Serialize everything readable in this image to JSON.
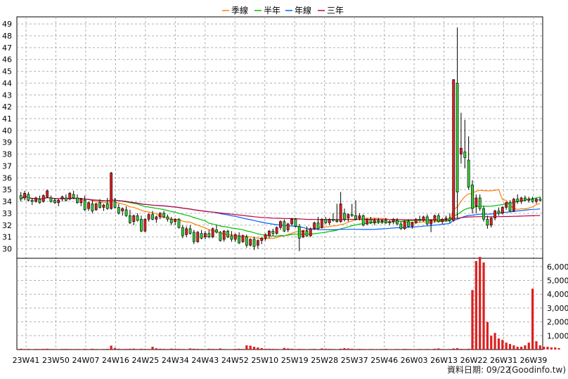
{
  "chart_data": {
    "type": "candlestick",
    "legend": [
      {
        "name": "季線",
        "color": "#ff8000"
      },
      {
        "name": "半年",
        "color": "#00c000"
      },
      {
        "name": "年線",
        "color": "#0060ff"
      },
      {
        "name": "三年",
        "color": "#c00040"
      }
    ],
    "price_axis": {
      "ticks": [
        30,
        31,
        32,
        33,
        34,
        35,
        36,
        37,
        38,
        39,
        40,
        41,
        42,
        43,
        44,
        45,
        46,
        47,
        48,
        49
      ],
      "ylim": [
        29.2,
        49.6
      ]
    },
    "volume_axis": {
      "ticks": [
        1000,
        2000,
        3000,
        4000,
        5000,
        6000
      ],
      "tick_labels": [
        "1,000",
        "2,000",
        "3,000",
        "4,000",
        "5,000",
        "6,000"
      ],
      "ylim": [
        0,
        6600
      ]
    },
    "x_labels": [
      "23W41",
      "23W50",
      "24W07",
      "24W16",
      "24W25",
      "24W34",
      "24W43",
      "24W52",
      "25W10",
      "25W19",
      "25W28",
      "25W37",
      "25W46",
      "26W03",
      "26W13",
      "26W22",
      "26W31",
      "26W39"
    ],
    "footer": "資料日期: 09/22",
    "footer_source": "(Goodinfo.tw)",
    "candles": [
      {
        "o": 34.5,
        "h": 34.8,
        "l": 34.0,
        "c": 34.2
      },
      {
        "o": 34.3,
        "h": 34.9,
        "l": 34.1,
        "c": 34.7
      },
      {
        "o": 34.6,
        "h": 34.8,
        "l": 34.0,
        "c": 34.1
      },
      {
        "o": 34.1,
        "h": 34.3,
        "l": 33.7,
        "c": 34.0
      },
      {
        "o": 34.0,
        "h": 34.4,
        "l": 33.9,
        "c": 34.3
      },
      {
        "o": 34.2,
        "h": 34.5,
        "l": 33.8,
        "c": 33.9
      },
      {
        "o": 34.0,
        "h": 34.6,
        "l": 33.9,
        "c": 34.5
      },
      {
        "o": 34.4,
        "h": 35.0,
        "l": 34.3,
        "c": 34.9
      },
      {
        "o": 34.3,
        "h": 34.5,
        "l": 33.9,
        "c": 34.0
      },
      {
        "o": 34.1,
        "h": 34.3,
        "l": 33.8,
        "c": 33.9
      },
      {
        "o": 33.9,
        "h": 34.2,
        "l": 33.6,
        "c": 34.1
      },
      {
        "o": 34.2,
        "h": 34.5,
        "l": 34.0,
        "c": 34.4
      },
      {
        "o": 34.3,
        "h": 34.6,
        "l": 34.0,
        "c": 34.1
      },
      {
        "o": 34.2,
        "h": 34.8,
        "l": 34.1,
        "c": 34.7
      },
      {
        "o": 34.6,
        "h": 34.9,
        "l": 34.2,
        "c": 34.3
      },
      {
        "o": 34.3,
        "h": 34.6,
        "l": 33.8,
        "c": 33.9
      },
      {
        "o": 33.9,
        "h": 34.3,
        "l": 33.6,
        "c": 34.2
      },
      {
        "o": 34.1,
        "h": 34.5,
        "l": 33.2,
        "c": 33.3
      },
      {
        "o": 33.4,
        "h": 34.0,
        "l": 33.2,
        "c": 33.9
      },
      {
        "o": 33.8,
        "h": 34.1,
        "l": 33.0,
        "c": 33.2
      },
      {
        "o": 33.3,
        "h": 33.9,
        "l": 33.2,
        "c": 33.8
      },
      {
        "o": 33.9,
        "h": 34.2,
        "l": 33.4,
        "c": 33.5
      },
      {
        "o": 33.5,
        "h": 33.8,
        "l": 33.2,
        "c": 33.7
      },
      {
        "o": 33.8,
        "h": 34.3,
        "l": 33.3,
        "c": 33.4
      },
      {
        "o": 33.4,
        "h": 36.5,
        "l": 33.3,
        "c": 36.4
      },
      {
        "o": 34.0,
        "h": 34.3,
        "l": 33.4,
        "c": 33.5
      },
      {
        "o": 33.5,
        "h": 33.8,
        "l": 32.9,
        "c": 33.0
      },
      {
        "o": 33.2,
        "h": 33.5,
        "l": 32.8,
        "c": 33.4
      },
      {
        "o": 33.3,
        "h": 33.6,
        "l": 32.7,
        "c": 32.8
      },
      {
        "o": 32.8,
        "h": 33.3,
        "l": 32.1,
        "c": 32.2
      },
      {
        "o": 32.3,
        "h": 32.9,
        "l": 32.0,
        "c": 32.8
      },
      {
        "o": 32.8,
        "h": 33.0,
        "l": 32.3,
        "c": 32.4
      },
      {
        "o": 32.5,
        "h": 32.8,
        "l": 31.4,
        "c": 31.5
      },
      {
        "o": 31.5,
        "h": 32.6,
        "l": 31.4,
        "c": 32.5
      },
      {
        "o": 32.5,
        "h": 33.0,
        "l": 32.3,
        "c": 32.9
      },
      {
        "o": 32.9,
        "h": 33.2,
        "l": 32.4,
        "c": 32.5
      },
      {
        "o": 32.5,
        "h": 32.8,
        "l": 32.2,
        "c": 32.7
      },
      {
        "o": 32.7,
        "h": 33.1,
        "l": 32.5,
        "c": 33.0
      },
      {
        "o": 33.0,
        "h": 33.2,
        "l": 32.6,
        "c": 32.7
      },
      {
        "o": 32.7,
        "h": 32.9,
        "l": 32.3,
        "c": 32.5
      },
      {
        "o": 32.5,
        "h": 32.7,
        "l": 32.0,
        "c": 32.2
      },
      {
        "o": 32.3,
        "h": 32.6,
        "l": 32.0,
        "c": 32.5
      },
      {
        "o": 32.5,
        "h": 32.6,
        "l": 31.7,
        "c": 31.8
      },
      {
        "o": 31.8,
        "h": 32.0,
        "l": 30.9,
        "c": 31.1
      },
      {
        "o": 31.2,
        "h": 31.9,
        "l": 31.0,
        "c": 31.7
      },
      {
        "o": 31.7,
        "h": 32.0,
        "l": 31.2,
        "c": 31.3
      },
      {
        "o": 31.4,
        "h": 31.6,
        "l": 30.4,
        "c": 30.6
      },
      {
        "o": 30.6,
        "h": 31.5,
        "l": 30.5,
        "c": 31.4
      },
      {
        "o": 31.3,
        "h": 31.6,
        "l": 30.8,
        "c": 30.9
      },
      {
        "o": 31.0,
        "h": 31.5,
        "l": 30.8,
        "c": 31.3
      },
      {
        "o": 31.3,
        "h": 31.6,
        "l": 30.9,
        "c": 31.0
      },
      {
        "o": 31.0,
        "h": 31.8,
        "l": 30.9,
        "c": 31.7
      },
      {
        "o": 31.6,
        "h": 32.0,
        "l": 31.3,
        "c": 31.4
      },
      {
        "o": 31.4,
        "h": 31.5,
        "l": 30.6,
        "c": 30.7
      },
      {
        "o": 30.8,
        "h": 31.6,
        "l": 30.6,
        "c": 31.5
      },
      {
        "o": 31.5,
        "h": 31.6,
        "l": 30.9,
        "c": 31.0
      },
      {
        "o": 31.1,
        "h": 31.5,
        "l": 30.6,
        "c": 30.8
      },
      {
        "o": 30.8,
        "h": 31.3,
        "l": 30.6,
        "c": 31.2
      },
      {
        "o": 31.1,
        "h": 31.4,
        "l": 30.4,
        "c": 30.5
      },
      {
        "o": 30.6,
        "h": 31.2,
        "l": 30.5,
        "c": 31.1
      },
      {
        "o": 31.0,
        "h": 31.2,
        "l": 30.1,
        "c": 30.3
      },
      {
        "o": 30.3,
        "h": 30.9,
        "l": 30.2,
        "c": 30.8
      },
      {
        "o": 30.8,
        "h": 31.0,
        "l": 29.9,
        "c": 30.2
      },
      {
        "o": 30.3,
        "h": 30.8,
        "l": 30.0,
        "c": 30.7
      },
      {
        "o": 30.7,
        "h": 31.0,
        "l": 30.4,
        "c": 30.9
      },
      {
        "o": 30.9,
        "h": 31.3,
        "l": 30.7,
        "c": 31.2
      },
      {
        "o": 31.1,
        "h": 31.6,
        "l": 30.9,
        "c": 31.5
      },
      {
        "o": 31.5,
        "h": 31.7,
        "l": 31.1,
        "c": 31.3
      },
      {
        "o": 31.3,
        "h": 31.9,
        "l": 31.2,
        "c": 31.8
      },
      {
        "o": 31.8,
        "h": 32.4,
        "l": 31.6,
        "c": 32.3
      },
      {
        "o": 32.3,
        "h": 32.5,
        "l": 31.4,
        "c": 31.5
      },
      {
        "o": 31.6,
        "h": 32.2,
        "l": 31.4,
        "c": 32.1
      },
      {
        "o": 32.1,
        "h": 32.6,
        "l": 32.0,
        "c": 32.5
      },
      {
        "o": 32.5,
        "h": 32.6,
        "l": 31.8,
        "c": 31.9
      },
      {
        "o": 31.9,
        "h": 32.1,
        "l": 29.8,
        "c": 30.9
      },
      {
        "o": 31.0,
        "h": 31.6,
        "l": 30.9,
        "c": 31.5
      },
      {
        "o": 31.5,
        "h": 31.9,
        "l": 31.0,
        "c": 31.1
      },
      {
        "o": 31.1,
        "h": 31.8,
        "l": 31.0,
        "c": 31.7
      },
      {
        "o": 31.7,
        "h": 32.3,
        "l": 31.6,
        "c": 32.2
      },
      {
        "o": 32.2,
        "h": 32.7,
        "l": 31.6,
        "c": 31.7
      },
      {
        "o": 31.8,
        "h": 32.6,
        "l": 31.7,
        "c": 32.5
      },
      {
        "o": 32.5,
        "h": 32.7,
        "l": 32.1,
        "c": 32.2
      },
      {
        "o": 32.2,
        "h": 32.6,
        "l": 32.0,
        "c": 32.5
      },
      {
        "o": 32.5,
        "h": 33.0,
        "l": 32.3,
        "c": 32.4
      },
      {
        "o": 32.4,
        "h": 33.8,
        "l": 32.2,
        "c": 32.3
      },
      {
        "o": 32.3,
        "h": 34.8,
        "l": 32.2,
        "c": 33.8
      },
      {
        "o": 33.0,
        "h": 33.4,
        "l": 32.3,
        "c": 32.5
      },
      {
        "o": 32.6,
        "h": 33.0,
        "l": 32.3,
        "c": 32.9
      },
      {
        "o": 32.9,
        "h": 33.8,
        "l": 32.7,
        "c": 32.8
      },
      {
        "o": 32.8,
        "h": 34.1,
        "l": 32.4,
        "c": 32.5
      },
      {
        "o": 32.6,
        "h": 33.0,
        "l": 32.4,
        "c": 32.8
      },
      {
        "o": 32.8,
        "h": 32.9,
        "l": 31.9,
        "c": 32.0
      },
      {
        "o": 32.1,
        "h": 32.6,
        "l": 32.0,
        "c": 32.5
      },
      {
        "o": 32.5,
        "h": 32.7,
        "l": 32.1,
        "c": 32.2
      },
      {
        "o": 32.2,
        "h": 32.6,
        "l": 32.0,
        "c": 32.4
      },
      {
        "o": 32.4,
        "h": 32.6,
        "l": 32.1,
        "c": 32.3
      },
      {
        "o": 32.3,
        "h": 32.5,
        "l": 32.1,
        "c": 32.4
      },
      {
        "o": 32.4,
        "h": 32.6,
        "l": 32.1,
        "c": 32.2
      },
      {
        "o": 32.2,
        "h": 32.4,
        "l": 32.0,
        "c": 32.3
      },
      {
        "o": 32.3,
        "h": 32.6,
        "l": 32.1,
        "c": 32.5
      },
      {
        "o": 32.4,
        "h": 32.6,
        "l": 32.0,
        "c": 32.1
      },
      {
        "o": 32.1,
        "h": 32.3,
        "l": 31.6,
        "c": 31.7
      },
      {
        "o": 31.7,
        "h": 32.4,
        "l": 31.6,
        "c": 32.3
      },
      {
        "o": 32.3,
        "h": 32.5,
        "l": 31.8,
        "c": 31.9
      },
      {
        "o": 31.9,
        "h": 32.3,
        "l": 31.7,
        "c": 32.2
      },
      {
        "o": 32.2,
        "h": 32.6,
        "l": 32.1,
        "c": 32.5
      },
      {
        "o": 32.5,
        "h": 32.8,
        "l": 32.3,
        "c": 32.4
      },
      {
        "o": 32.4,
        "h": 32.8,
        "l": 32.3,
        "c": 32.7
      },
      {
        "o": 32.7,
        "h": 32.9,
        "l": 32.0,
        "c": 32.1
      },
      {
        "o": 32.1,
        "h": 32.5,
        "l": 31.4,
        "c": 32.4
      },
      {
        "o": 32.4,
        "h": 32.9,
        "l": 32.2,
        "c": 32.8
      },
      {
        "o": 32.8,
        "h": 33.0,
        "l": 32.2,
        "c": 32.3
      },
      {
        "o": 32.3,
        "h": 32.6,
        "l": 32.1,
        "c": 32.5
      },
      {
        "o": 32.5,
        "h": 32.8,
        "l": 32.3,
        "c": 32.6
      },
      {
        "o": 32.6,
        "h": 33.0,
        "l": 32.2,
        "c": 32.4
      },
      {
        "o": 32.4,
        "h": 44.3,
        "l": 32.3,
        "c": 44.3
      },
      {
        "o": 44.0,
        "h": 48.7,
        "l": 32.6,
        "c": 34.8
      },
      {
        "o": 38.0,
        "h": 41.5,
        "l": 37.2,
        "c": 38.5
      },
      {
        "o": 38.2,
        "h": 40.9,
        "l": 36.8,
        "c": 37.7
      },
      {
        "o": 37.5,
        "h": 39.5,
        "l": 35.0,
        "c": 35.2
      },
      {
        "o": 35.4,
        "h": 35.8,
        "l": 33.0,
        "c": 33.4
      },
      {
        "o": 33.6,
        "h": 34.6,
        "l": 33.0,
        "c": 34.3
      },
      {
        "o": 34.3,
        "h": 34.6,
        "l": 33.2,
        "c": 33.4
      },
      {
        "o": 33.4,
        "h": 33.6,
        "l": 32.3,
        "c": 32.5
      },
      {
        "o": 32.5,
        "h": 32.8,
        "l": 31.7,
        "c": 32.0
      },
      {
        "o": 32.0,
        "h": 32.7,
        "l": 31.8,
        "c": 32.6
      },
      {
        "o": 32.6,
        "h": 33.3,
        "l": 32.4,
        "c": 33.2
      },
      {
        "o": 33.2,
        "h": 33.5,
        "l": 32.8,
        "c": 33.0
      },
      {
        "o": 33.0,
        "h": 33.6,
        "l": 32.9,
        "c": 33.5
      },
      {
        "o": 33.5,
        "h": 34.0,
        "l": 33.3,
        "c": 33.9
      },
      {
        "o": 33.9,
        "h": 34.1,
        "l": 33.1,
        "c": 33.2
      },
      {
        "o": 33.2,
        "h": 34.3,
        "l": 33.1,
        "c": 34.2
      },
      {
        "o": 34.2,
        "h": 34.6,
        "l": 33.8,
        "c": 34.0
      },
      {
        "o": 34.0,
        "h": 34.4,
        "l": 33.8,
        "c": 34.3
      },
      {
        "o": 34.3,
        "h": 34.5,
        "l": 34.0,
        "c": 34.1
      },
      {
        "o": 34.1,
        "h": 34.4,
        "l": 33.9,
        "c": 34.2
      },
      {
        "o": 34.2,
        "h": 34.4,
        "l": 33.9,
        "c": 34.0
      },
      {
        "o": 34.0,
        "h": 34.3,
        "l": 33.8,
        "c": 34.2
      },
      {
        "o": 34.2,
        "h": 34.4,
        "l": 34.0,
        "c": 34.1
      }
    ],
    "volume": [
      60,
      40,
      50,
      30,
      45,
      40,
      50,
      60,
      40,
      35,
      30,
      45,
      50,
      40,
      35,
      40,
      30,
      50,
      30,
      60,
      40,
      30,
      40,
      50,
      280,
      120,
      60,
      40,
      50,
      60,
      70,
      40,
      60,
      50,
      40,
      200,
      90,
      60,
      50,
      40,
      70,
      60,
      50,
      40,
      30,
      80,
      60,
      50,
      40,
      30,
      60,
      50,
      40,
      80,
      40,
      30,
      30,
      50,
      60,
      40,
      300,
      280,
      200,
      150,
      100,
      60,
      60,
      50,
      40,
      30,
      120,
      80,
      60,
      40,
      50,
      40,
      30,
      40,
      50,
      30,
      80,
      60,
      50,
      40,
      30,
      60,
      100,
      80,
      60,
      40,
      50,
      40,
      30,
      40,
      30,
      30,
      40,
      50,
      30,
      30,
      40,
      30,
      50,
      40,
      30,
      30,
      40,
      30,
      40,
      30,
      60,
      80,
      40,
      30,
      40,
      80,
      100,
      50,
      40,
      60,
      4300,
      6400,
      6700,
      6300,
      2000,
      1000,
      1200,
      800,
      700,
      500,
      400,
      300,
      200,
      200,
      300,
      500,
      4400,
      600,
      300,
      200,
      200,
      150,
      150,
      100
    ]
  }
}
